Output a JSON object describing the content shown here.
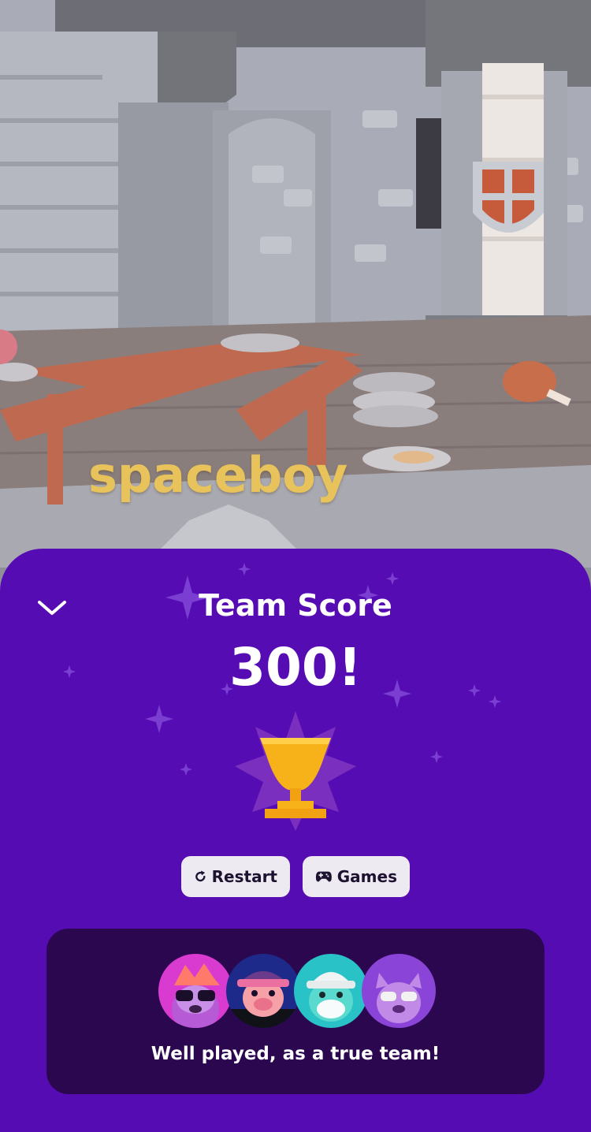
{
  "game": {
    "player_name": "spaceboy"
  },
  "result_panel": {
    "title": "Team Score",
    "score": "300!",
    "collapse_icon": "chevron-down-icon",
    "trophy_icon": "trophy-icon",
    "colors": {
      "panel": "#560cb3",
      "card": "#2b0750",
      "button": "#eeeaf2",
      "trophy": "#f7b21a"
    }
  },
  "actions": {
    "restart_label": "Restart",
    "restart_icon": "restart-icon",
    "games_label": "Games",
    "games_icon": "gamepad-icon"
  },
  "team": {
    "message": "Well played, as a true team!",
    "avatars": [
      "pink-sloth-avatar",
      "pig-cap-avatar",
      "teal-bear-avatar",
      "purple-cat-avatar"
    ]
  }
}
